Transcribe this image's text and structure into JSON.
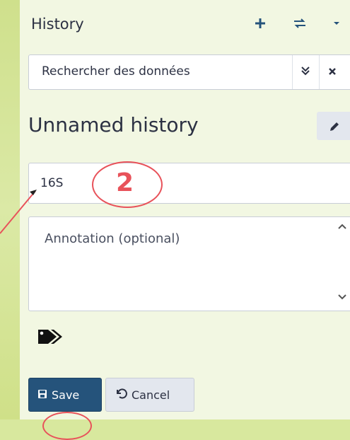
{
  "header": {
    "title": "History",
    "icons": [
      "plus-icon",
      "switch-icon",
      "caret-down-icon"
    ]
  },
  "search": {
    "placeholder": "Rechercher des données"
  },
  "history": {
    "name": "Unnamed history"
  },
  "editor": {
    "name_value": "16S",
    "annotation_placeholder": "Annotation (optional)",
    "save_label": "Save",
    "cancel_label": "Cancel"
  },
  "annotation": {
    "step_number": "2",
    "color": "#e8525a"
  },
  "colors": {
    "primary": "#25537b",
    "background": "#f2f7e2"
  }
}
